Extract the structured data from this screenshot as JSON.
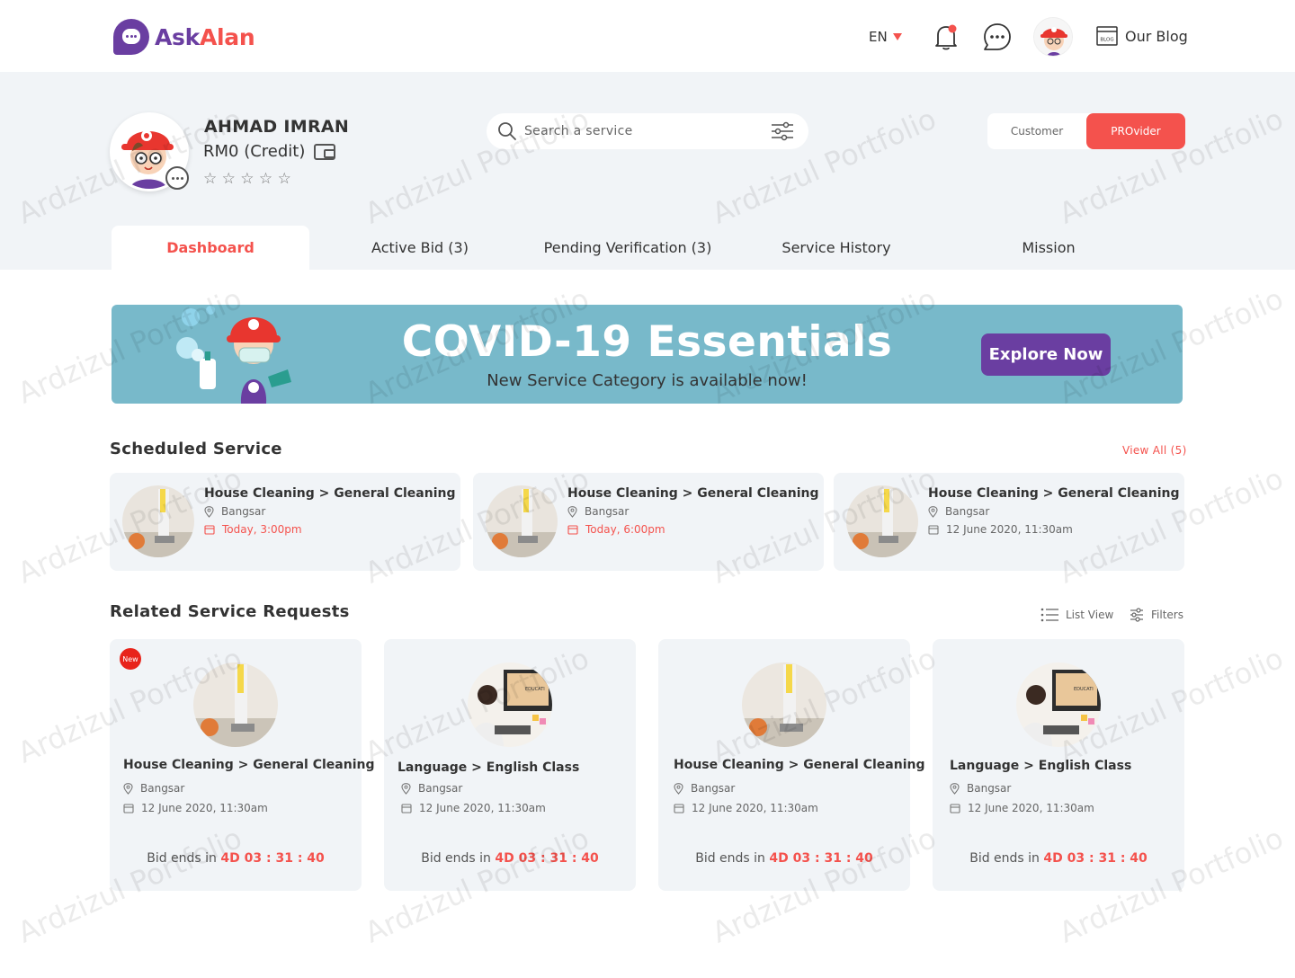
{
  "brand": {
    "name_part1": "Ask",
    "name_part2": "Alan"
  },
  "header": {
    "language": "EN",
    "blog_label": "Our Blog",
    "blog_icon_text": "BLOG"
  },
  "profile": {
    "name": "AHMAD IMRAN",
    "credit": "RM0 (Credit)",
    "stars": "☆ ☆ ☆ ☆ ☆",
    "rating": 0
  },
  "search": {
    "placeholder": "Search a service"
  },
  "role_toggle": {
    "customer": "Customer",
    "provider": "PROvider",
    "active": "provider"
  },
  "tabs": [
    {
      "label": "Dashboard",
      "active": true
    },
    {
      "label": "Active Bid (3)"
    },
    {
      "label": "Pending Verification (3)"
    },
    {
      "label": "Service History"
    },
    {
      "label": "Mission"
    }
  ],
  "banner": {
    "title": "COVID-19 Essentials",
    "subtitle": "New Service Category is available now!",
    "button": "Explore Now"
  },
  "scheduled": {
    "title": "Scheduled Service",
    "view_all": "View All (5)",
    "items": [
      {
        "title": "House Cleaning > General Cleaning",
        "location": "Bangsar",
        "time": "Today, 3:00pm"
      },
      {
        "title": "House Cleaning > General Cleaning",
        "location": "Bangsar",
        "time": "Today, 6:00pm"
      },
      {
        "title": "House Cleaning > General Cleaning",
        "location": "Bangsar",
        "time": "12 June 2020, 11:30am"
      }
    ]
  },
  "related": {
    "title": "Related Service Requests",
    "list_view": "List View",
    "filters": "Filters",
    "new_badge": "New",
    "bid_prefix": "Bid ends in",
    "items": [
      {
        "title": "House Cleaning > General Cleaning",
        "location": "Bangsar",
        "date": "12 June 2020, 11:30am",
        "countdown": "4D 03 : 31 : 40"
      },
      {
        "title": "Language > English Class",
        "location": "Bangsar",
        "date": "12 June 2020, 11:30am",
        "countdown": "4D 03 : 31 : 40"
      },
      {
        "title": "House Cleaning > General Cleaning",
        "location": "Bangsar",
        "date": "12 June 2020, 11:30am",
        "countdown": "4D 03 : 31 : 40"
      },
      {
        "title": "Language > English Class",
        "location": "Bangsar",
        "date": "12 June 2020, 11:30am",
        "countdown": "4D 03 : 31 : 40"
      }
    ]
  },
  "watermark": "Ardzizul Portfolio",
  "colors": {
    "brand_purple": "#6a3ea1",
    "accent_red": "#f4524d",
    "banner_teal": "#78b9ca",
    "panel_grey": "#f1f4f7"
  }
}
